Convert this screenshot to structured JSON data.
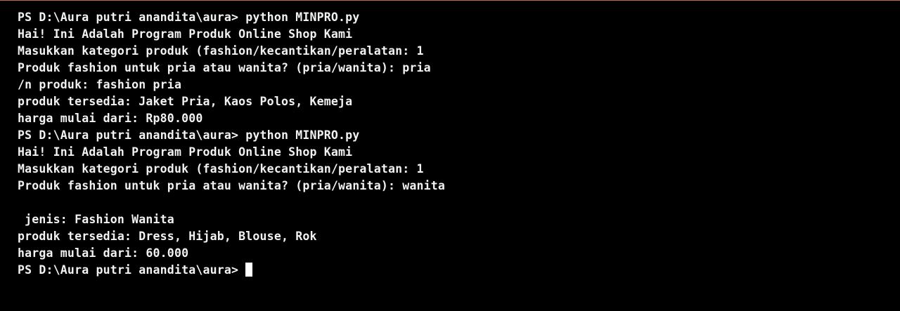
{
  "terminal": {
    "lines": [
      "PS D:\\Aura putri anandita\\aura> python MINPRO.py",
      "Hai! Ini Adalah Program Produk Online Shop Kami",
      "Masukkan kategori produk (fashion/kecantikan/peralatan: 1",
      "Produk fashion untuk pria atau wanita? (pria/wanita): pria",
      "/n produk: fashion pria",
      "produk tersedia: Jaket Pria, Kaos Polos, Kemeja",
      "harga mulai dari: Rp80.000",
      "PS D:\\Aura putri anandita\\aura> python MINPRO.py",
      "Hai! Ini Adalah Program Produk Online Shop Kami",
      "Masukkan kategori produk (fashion/kecantikan/peralatan: 1",
      "Produk fashion untuk pria atau wanita? (pria/wanita): wanita",
      "",
      " jenis: Fashion Wanita",
      "produk tersedia: Dress, Hijab, Blouse, Rok",
      "harga mulai dari: 60.000"
    ],
    "prompt": "PS D:\\Aura putri anandita\\aura>",
    "colors": {
      "background": "#000000",
      "text": "#f2f2f2",
      "cursor": "#ffffff",
      "top_border": "#c0703a"
    }
  }
}
